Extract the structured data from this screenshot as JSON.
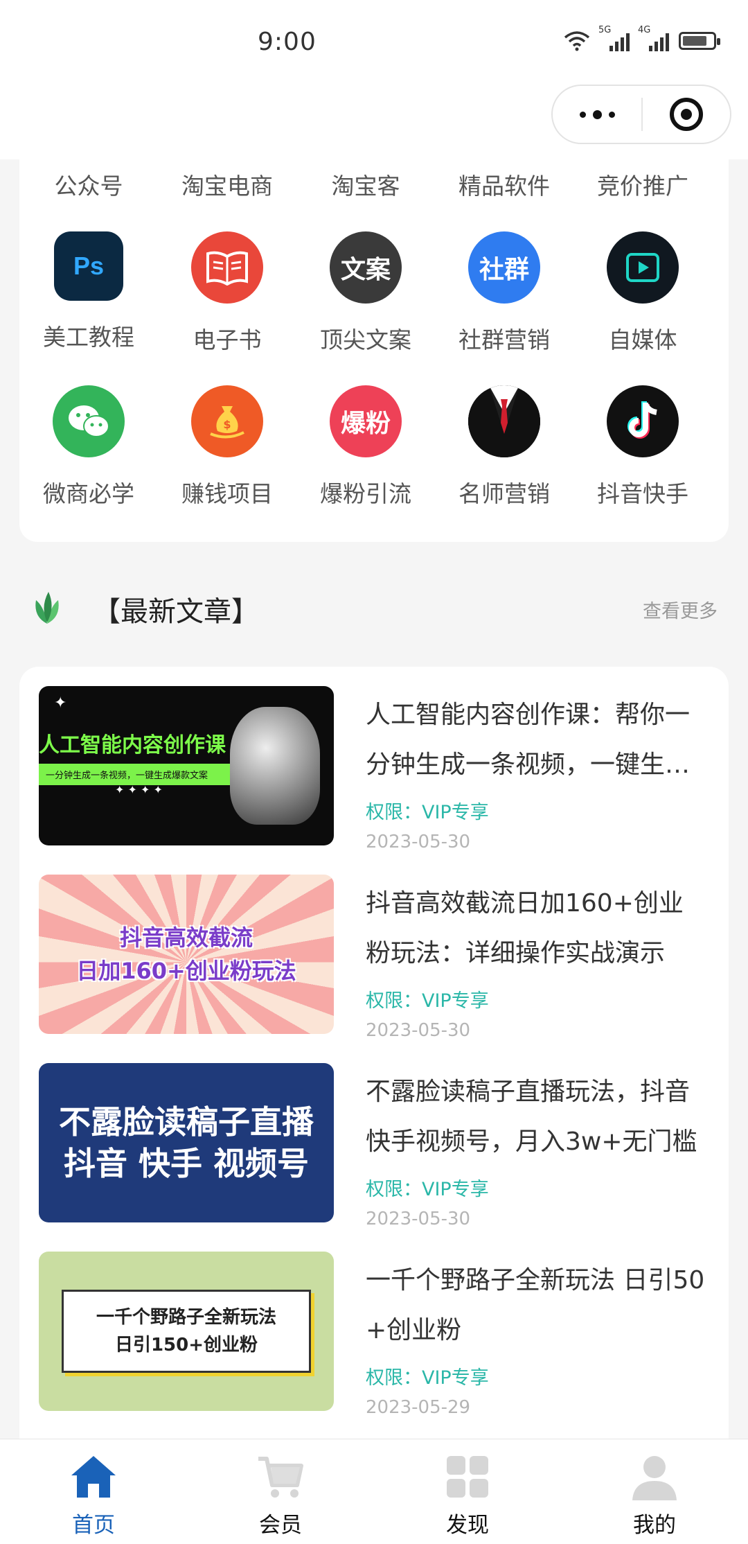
{
  "status_bar": {
    "time": "9:00",
    "signal1_tag": "5G",
    "signal2_tag": "4G"
  },
  "categories_row0": [
    "公众号",
    "淘宝电商",
    "淘宝客",
    "精品软件",
    "竞价推广"
  ],
  "categories": [
    {
      "label": "美工教程",
      "icon": "ps-icon",
      "glyph": "Ps",
      "color": "#0b2942"
    },
    {
      "label": "电子书",
      "icon": "book-icon",
      "glyph": "",
      "color": "#e9473a"
    },
    {
      "label": "顶尖文案",
      "icon": "copywriting-icon",
      "glyph": "文案",
      "color": "#3a3a3a"
    },
    {
      "label": "社群营销",
      "icon": "community-icon",
      "glyph": "社群",
      "color": "#2f7cf0"
    },
    {
      "label": "自媒体",
      "icon": "video-icon",
      "glyph": "",
      "color": "#101820"
    },
    {
      "label": "微商必学",
      "icon": "wechat-icon",
      "glyph": "",
      "color": "#33b45a"
    },
    {
      "label": "赚钱项目",
      "icon": "money-bag-icon",
      "glyph": "",
      "color": "#ef5a26"
    },
    {
      "label": "爆粉引流",
      "icon": "fans-icon",
      "glyph": "爆粉",
      "color": "#ee4157"
    },
    {
      "label": "名师营销",
      "icon": "suit-icon",
      "glyph": "",
      "color": "#2a2a2a"
    },
    {
      "label": "抖音快手",
      "icon": "tiktok-icon",
      "glyph": "",
      "color": "#111111"
    }
  ],
  "section": {
    "title": "【最新文章】",
    "more": "查看更多"
  },
  "articles": [
    {
      "title": "人工智能内容创作课：帮你一分钟生成一条视频，一键生成爆款文案",
      "permission": "权限：VIP专享",
      "date": "2023-05-30",
      "thumb_line1": "人工智能内容创作课",
      "thumb_line2": "一分钟生成一条视频，一键生成爆款文案"
    },
    {
      "title": "抖音高效截流日加160+创业粉玩法：详细操作实战演示",
      "permission": "权限：VIP专享",
      "date": "2023-05-30",
      "thumb_line1": "抖音高效截流",
      "thumb_line2": "日加160+创业粉玩法"
    },
    {
      "title": "不露脸读稿子直播玩法，抖音快手视频号，月入3w+无门槛",
      "permission": "权限：VIP专享",
      "date": "2023-05-30",
      "thumb_line1": "不露脸读稿子直播",
      "thumb_line2": "抖音 快手 视频号"
    },
    {
      "title": "一千个野路子全新玩法 日引50+创业粉",
      "permission": "权限：VIP专享",
      "date": "2023-05-29",
      "thumb_line1": "一千个野路子全新玩法",
      "thumb_line2": "日引150+创业粉"
    }
  ],
  "tabbar": [
    {
      "label": "首页",
      "icon": "home-icon",
      "active": true
    },
    {
      "label": "会员",
      "icon": "cart-icon",
      "active": false
    },
    {
      "label": "发现",
      "icon": "grid-icon",
      "active": false
    },
    {
      "label": "我的",
      "icon": "user-icon",
      "active": false
    }
  ],
  "colors": {
    "accent": "#1a62b8",
    "permission": "#2bb7a8",
    "date": "#b5b5b5"
  }
}
